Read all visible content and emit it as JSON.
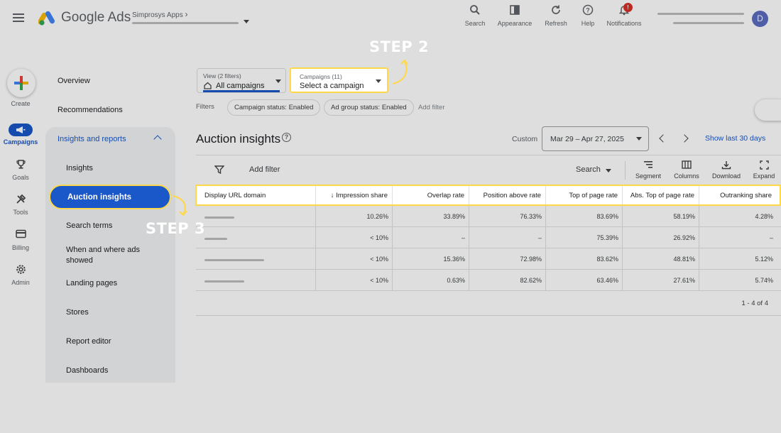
{
  "topbar": {
    "brand": "Google Ads",
    "account_label": "Simprosys Apps",
    "account_chevron": "›",
    "buttons": [
      {
        "label": "Search",
        "icon": "search-icon"
      },
      {
        "label": "Appearance",
        "icon": "appearance-icon"
      },
      {
        "label": "Refresh",
        "icon": "refresh-icon"
      },
      {
        "label": "Help",
        "icon": "help-icon"
      },
      {
        "label": "Notifications",
        "icon": "bell-icon",
        "badge": "!"
      }
    ],
    "avatar_letter": "D"
  },
  "rail": {
    "items": [
      {
        "label": "Create",
        "icon": "plus-icon"
      },
      {
        "label": "Campaigns",
        "icon": "megaphone-icon",
        "active": true
      },
      {
        "label": "Goals",
        "icon": "trophy-icon"
      },
      {
        "label": "Tools",
        "icon": "tools-icon"
      },
      {
        "label": "Billing",
        "icon": "card-icon"
      },
      {
        "label": "Admin",
        "icon": "gear-icon"
      }
    ]
  },
  "sidenav": {
    "top_items": [
      "Overview",
      "Recommendations"
    ],
    "section": "Insights and reports",
    "sub_items": [
      "Insights",
      "Auction insights",
      "Search terms",
      "When and where ads showed",
      "Landing pages",
      "Stores",
      "Report editor",
      "Dashboards"
    ],
    "active": "Auction insights"
  },
  "filterbar": {
    "view_label": "View (2 filters)",
    "view_value": "All campaigns",
    "campaign_label": "Campaigns (11)",
    "campaign_value": "Select a campaign",
    "filters_label": "Filters",
    "chips": [
      "Campaign status: Enabled",
      "Ad group status: Enabled"
    ],
    "add_filter": "Add filter"
  },
  "report": {
    "title": "Auction insights",
    "custom_label": "Custom",
    "date_range": "Mar 29 – Apr 27, 2025",
    "show_last": "Show last 30 days"
  },
  "toolbar": {
    "add_filter": "Add filter",
    "search": "Search",
    "buttons": [
      "Segment",
      "Columns",
      "Download",
      "Expand"
    ]
  },
  "table": {
    "columns": [
      "Display URL domain",
      "Impression share",
      "Overlap rate",
      "Position above rate",
      "Top of page rate",
      "Abs. Top of page rate",
      "Outranking share"
    ],
    "sort_arrow": "↓",
    "rows": [
      [
        "10.26%",
        "33.89%",
        "76.33%",
        "83.69%",
        "58.19%",
        "4.28%"
      ],
      [
        "< 10%",
        "–",
        "–",
        "75.39%",
        "26.92%",
        "–"
      ],
      [
        "< 10%",
        "15.36%",
        "72.98%",
        "83.62%",
        "48.81%",
        "5.12%"
      ],
      [
        "< 10%",
        "0.63%",
        "82.62%",
        "63.46%",
        "27.61%",
        "5.74%"
      ]
    ],
    "pagination": "1 - 4 of 4"
  },
  "annotations": {
    "step2": "STEP 2",
    "step3": "STEP 3"
  },
  "colors": {
    "primary_blue": "#1a57c8",
    "highlight_yellow": "#ffd84a",
    "notification_red": "#d93025"
  }
}
